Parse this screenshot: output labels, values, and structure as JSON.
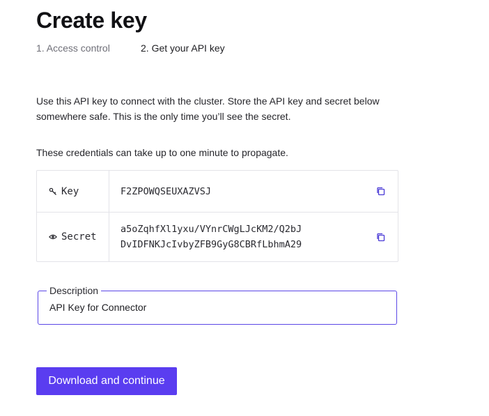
{
  "header": {
    "title": "Create key"
  },
  "steps": [
    {
      "label": "1. Access control",
      "state": "done"
    },
    {
      "label": "2. Get your API key",
      "state": "active"
    }
  ],
  "content": {
    "intro": "Use this API key to connect with the cluster. Store the API key and secret below somewhere safe. This is the only time you’ll see the secret.",
    "note": "These credentials can take up to one minute to propagate."
  },
  "credentials": {
    "key": {
      "label": "Key",
      "icon": "key-icon",
      "value": "F2ZPOWQSEUXAZVSJ"
    },
    "secret": {
      "label": "Secret",
      "icon": "eye-icon",
      "value_line1": "a5oZqhfXl1yxu/VYnrCWgLJcKM2/Q2bJ",
      "value_line2": "DvIDFNKJcIvbyZFB9GyG8CBRfLbhmA29"
    },
    "copy_icon": "copy-icon"
  },
  "description": {
    "legend": "Description",
    "value": "API Key for Connector"
  },
  "actions": {
    "primary_label": "Download and continue"
  },
  "colors": {
    "accent": "#5a3df0",
    "field_border": "#5b47e6",
    "border": "#e3e3e8",
    "muted_text": "#6f6f78"
  }
}
